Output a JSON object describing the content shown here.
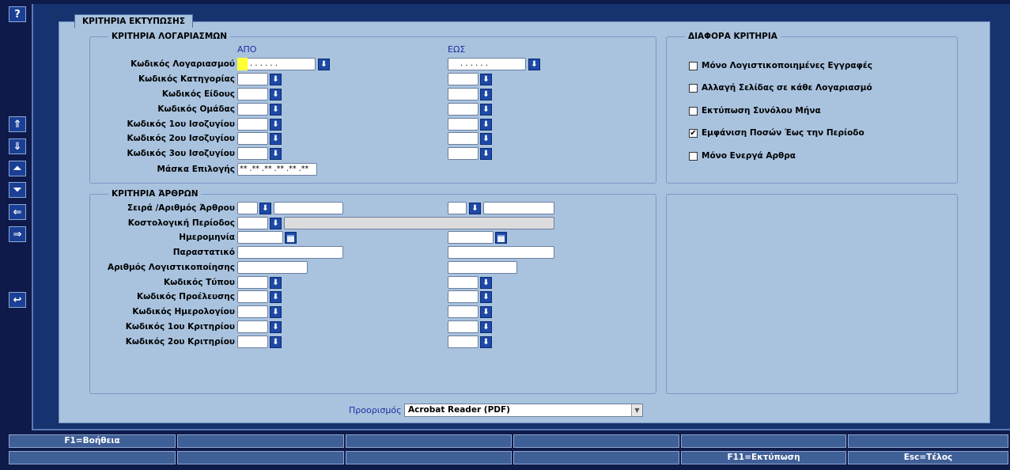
{
  "side_buttons": {
    "help": "?",
    "first": "⇑",
    "next": "⇓",
    "prev_block": "⏶",
    "next_block": "⏷",
    "left": "⇐",
    "right": "⇒",
    "back": "↩"
  },
  "panel_tab": "ΚΡΙΤΗΡΙΑ ΕΚΤΥΠΩΣΗΣ",
  "accounts": {
    "title": "ΚΡΙΤΗΡΙΑ ΛΟΓΑΡΙΑΣΜΩΝ",
    "from_header": "ΑΠΟ",
    "to_header": "ΕΩΣ",
    "account_code_label": "Κωδικός Λογαριασμού",
    "account_code_from": ".  .  .  .  .  .",
    "account_code_to": ".  .  .  .  .  .",
    "category_label": "Κωδικός Κατηγορίας",
    "type_label": "Κωδικός Είδους",
    "group_label": "Κωδικός Ομάδας",
    "balance1_label": "Κωδικός 1ου Ισοζυγίου",
    "balance2_label": "Κωδικός 2ου Ισοζυγίου",
    "balance3_label": "Κωδικός 3ου Ισοζυγίου",
    "mask_label": "Μάσκα Επιλογής",
    "mask_value": "** .** .** .** .** .**"
  },
  "misc": {
    "title": "ΔΙΑΦΟΡΑ ΚΡΙΤΗΡΙΑ",
    "options": [
      {
        "label": "Μόνο Λογιστικοποιημένες Εγγραφές",
        "checked": false
      },
      {
        "label": "Αλλαγή Σελίδας σε κάθε Λογαριασμό",
        "checked": false
      },
      {
        "label": "Εκτύπωση Συνόλου Μήνα",
        "checked": false
      },
      {
        "label": "Εμφάνιση Ποσών Έως την Περίοδο",
        "checked": true
      },
      {
        "label": "Μόνο Ενεργά Αρθρα",
        "checked": false
      }
    ]
  },
  "articles": {
    "title": "ΚΡΙΤΗΡΙΑ ΆΡΘΡΩΝ",
    "series_label": "Σειρά /Αριθμός Άρθρου",
    "period_label": "Κοστολογική Περίοδος",
    "date_label": "Ημερομηνία",
    "document_label": "Παραστατικό",
    "posting_label": "Αριθμός Λογιστικοποίησης",
    "type_code_label": "Κωδικός Τύπου",
    "origin_label": "Κωδικός Προέλευσης",
    "journal_label": "Κωδικός Ημερολογίου",
    "crit1_label": "Κωδικός 1ου Κριτηρίου",
    "crit2_label": "Κωδικός 2ου Κριτηρίου"
  },
  "destination": {
    "label": "Προορισμός",
    "value": "Acrobat Reader (PDF)"
  },
  "function_keys": {
    "row1": [
      "F1=Βοήθεια",
      "",
      "",
      "",
      "",
      ""
    ],
    "row2": [
      "",
      "",
      "",
      "",
      "F11=Εκτύπωση",
      "Esc=Τέλος"
    ]
  },
  "icons": {
    "lov": "down-arrow-icon",
    "calendar": "calendar-icon"
  },
  "colors": {
    "background": "#0d1a4a",
    "panel": "#a9c3df",
    "highlight": "#ffff33",
    "header_text": "#1a2fa0"
  }
}
